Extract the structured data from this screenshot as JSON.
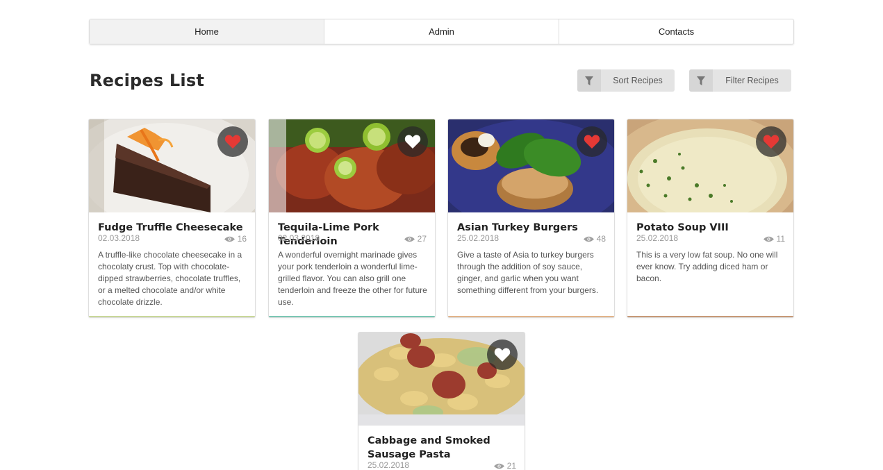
{
  "nav": {
    "items": [
      {
        "label": "Home",
        "active": true
      },
      {
        "label": "Admin",
        "active": false
      },
      {
        "label": "Contacts",
        "active": false
      }
    ]
  },
  "header": {
    "title": "Recipes List",
    "sort_label": "Sort Recipes",
    "filter_label": "Filter Recipes",
    "icon": "filter-icon"
  },
  "recipes": [
    {
      "title": "Fudge Truffle Cheesecake",
      "date": "02.03.2018",
      "views": "16",
      "favorite": true,
      "description": "A truffle-like chocolate cheesecake in a chocolaty crust. Top with chocolate-dipped strawberries, chocolate truffles, or a melted chocolate and/or white chocolate drizzle.",
      "accent": "#c9d79a"
    },
    {
      "title": "Tequila-Lime Pork Tenderloin",
      "date": "02.03.2018",
      "views": "27",
      "favorite": false,
      "description": "A wonderful overnight marinade gives your pork tenderloin a wonderful lime-grilled flavor. You can also grill one tenderloin and freeze the other for future use.",
      "accent": "#7cc7b4"
    },
    {
      "title": "Asian Turkey Burgers",
      "date": "25.02.2018",
      "views": "48",
      "favorite": true,
      "description": "Give a taste of Asia to turkey burgers through the addition of soy sauce, ginger, and garlic when you want something different from your burgers.",
      "accent": "#e2b48a"
    },
    {
      "title": "Potato Soup VIII",
      "date": "25.02.2018",
      "views": "11",
      "favorite": true,
      "description": "This is a very low fat soup. No one will ever know. Try adding diced ham or bacon.",
      "accent": "#c79a78"
    },
    {
      "title": "Cabbage and Smoked Sausage Pasta",
      "date": "25.02.2018",
      "views": "21",
      "favorite": false,
      "description": "",
      "accent": "#dddddd"
    }
  ],
  "colors": {
    "heart_red": "#e53935",
    "heart_white": "#ffffff",
    "fav_bg": "#333333"
  }
}
